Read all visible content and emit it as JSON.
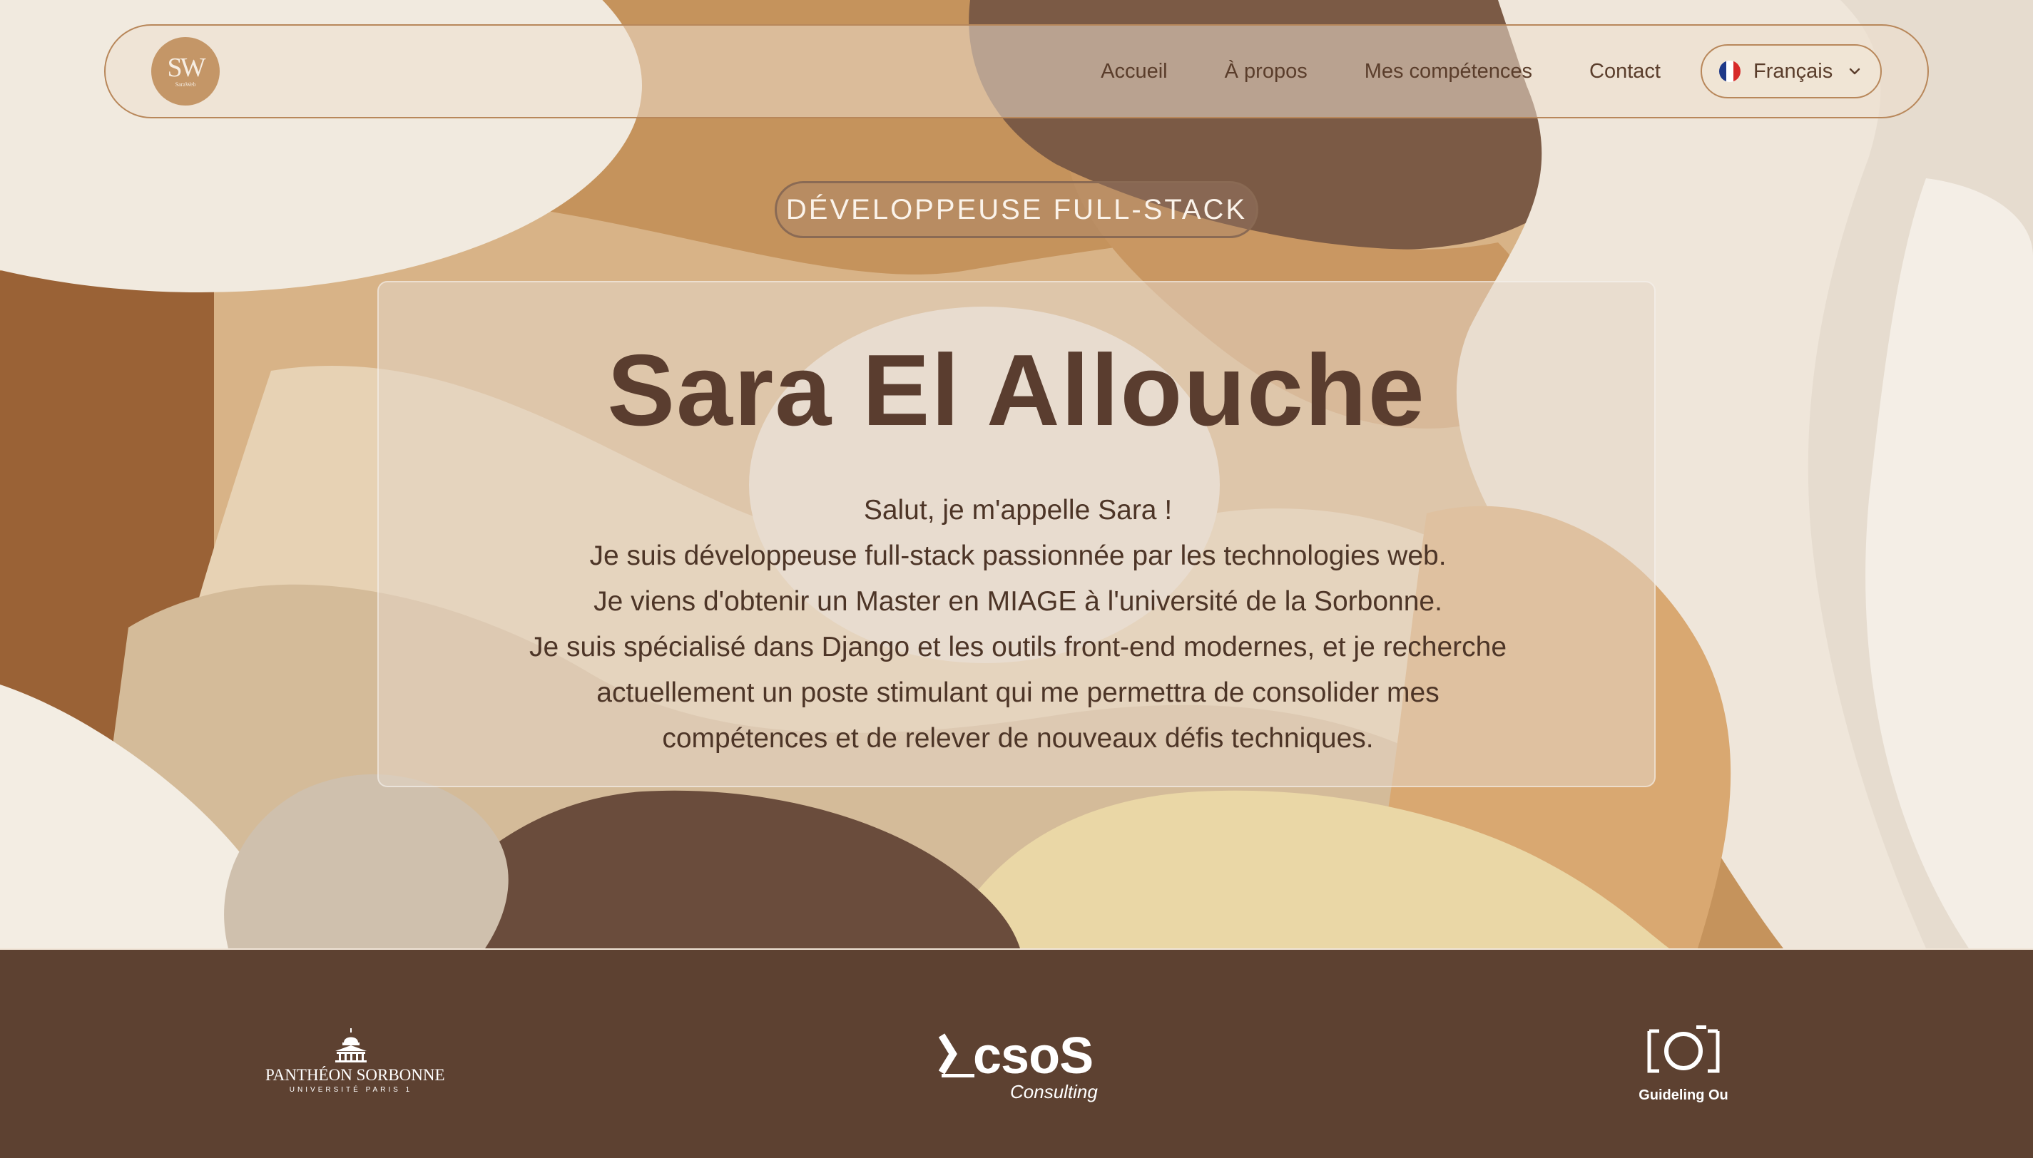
{
  "nav": {
    "logo_mono": "SW",
    "logo_small": "SaraWeb",
    "links": [
      "Accueil",
      "À propos",
      "Mes compétences",
      "Contact"
    ],
    "language": "Français"
  },
  "hero": {
    "badge": "DÉVELOPPEUSE FULL-STACK",
    "name": "Sara El Allouche",
    "bio": [
      "Salut, je m'appelle Sara !",
      "Je suis développeuse full-stack passionnée par les technologies web.",
      "Je viens d'obtenir un Master en MIAGE à l'université de la Sorbonne.",
      "Je suis spécialisé dans Django et les outils front-end modernes, et je recherche",
      "actuellement un poste stimulant qui me permettra de consolider mes",
      "compétences et de relever de nouveaux défis techniques."
    ]
  },
  "partners": {
    "pantheon_name": "PANTHÉON SORBONNE",
    "pantheon_sub": "UNIVERSITÉ PARIS 1",
    "csos_name": "csoS",
    "csos_sub": "Consulting",
    "guide_name": "Guideling Ou"
  },
  "colors": {
    "brand_brown": "#5a3d2f",
    "band_brown": "#5d4131",
    "accent_tan": "#c49667",
    "flag_blue": "#1f3a8a",
    "flag_red": "#d72b2b"
  },
  "icons": [
    "chevron-down-icon",
    "france-flag-icon",
    "pantheon-building-icon",
    "camera-frame-icon"
  ]
}
